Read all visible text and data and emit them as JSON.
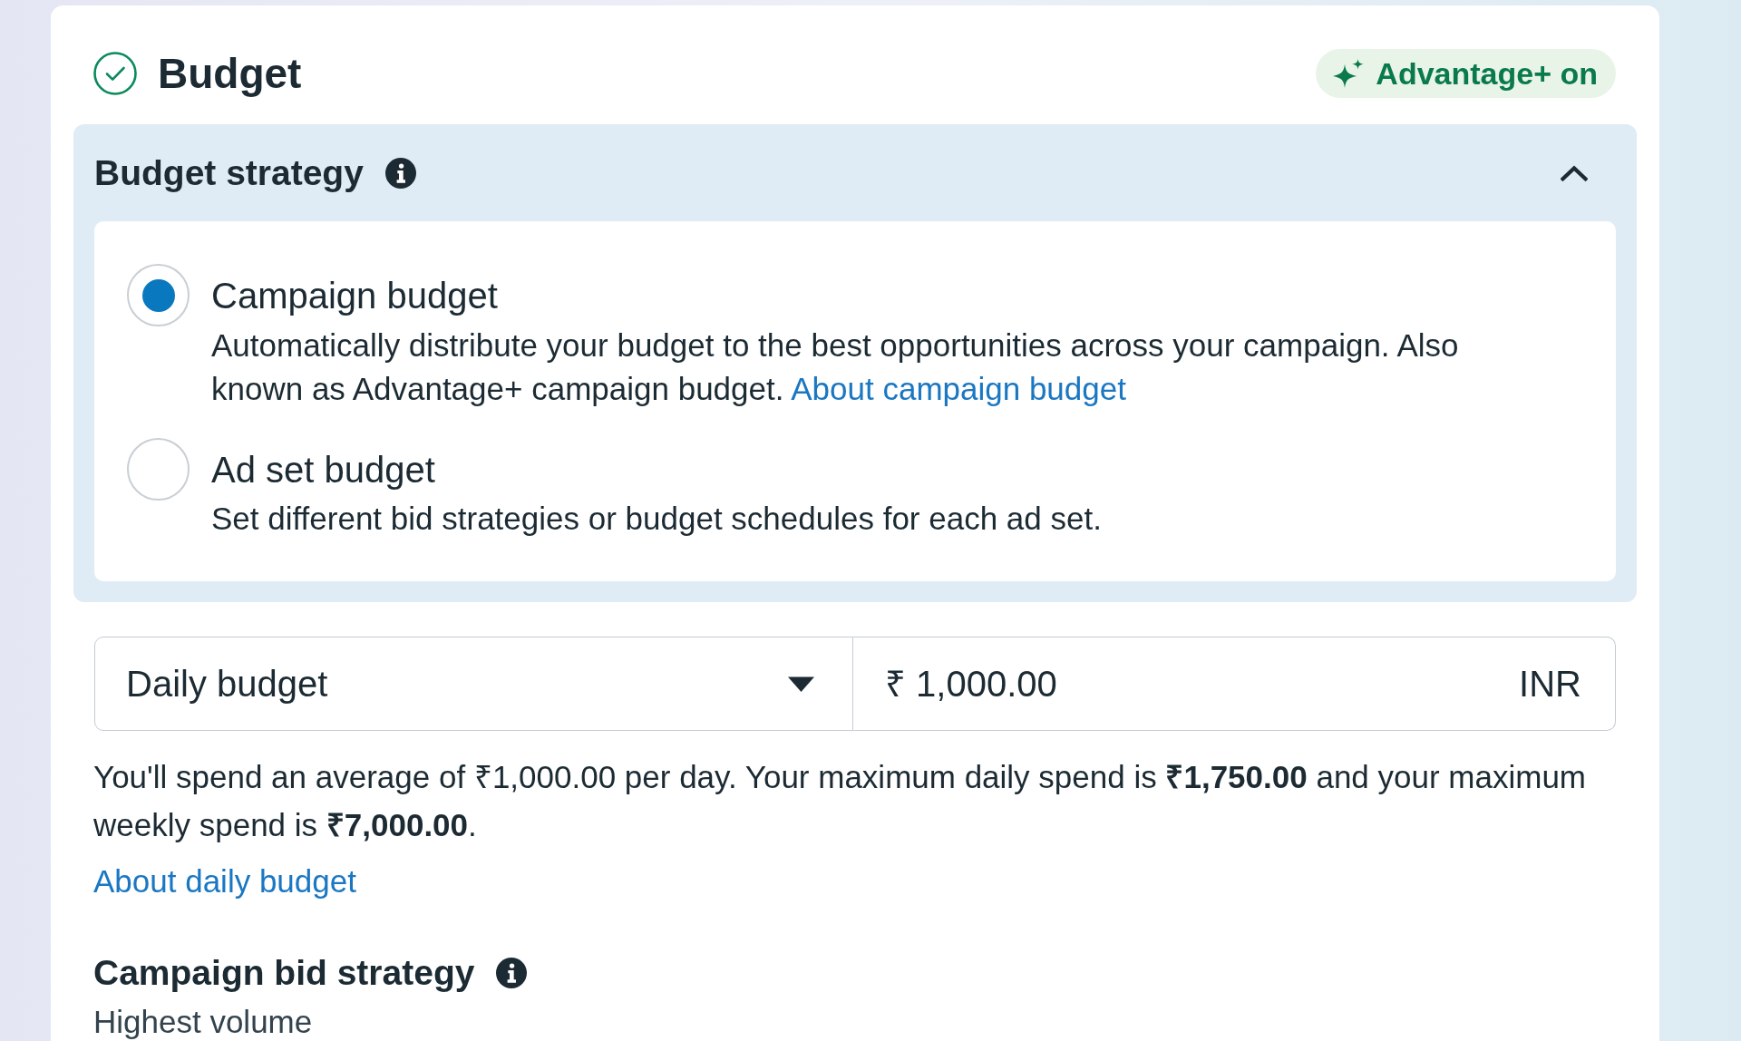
{
  "section": {
    "title": "Budget",
    "completed": true,
    "badge": "Advantage+ on"
  },
  "budget_strategy": {
    "title": "Budget strategy",
    "expanded": true,
    "options": [
      {
        "label": "Campaign budget",
        "description": "Automatically distribute your budget to the best opportunities across your campaign. Also known as Advantage+ campaign budget.",
        "link": "About campaign budget",
        "selected": true
      },
      {
        "label": "Ad set budget",
        "description": "Set different bid strategies or budget schedules for each ad set.",
        "selected": false
      }
    ]
  },
  "budget": {
    "type": "Daily budget",
    "amount": "₹ 1,000.00",
    "currency": "INR",
    "summary": "You'll spend an average of ₹1,000.00 per day. Your maximum daily spend is **₹1,750.00** and your maximum weekly spend is **₹7,000.00**.",
    "link": "About daily budget"
  },
  "bid_strategy": {
    "title": "Campaign bid strategy",
    "value": "Highest volume"
  }
}
